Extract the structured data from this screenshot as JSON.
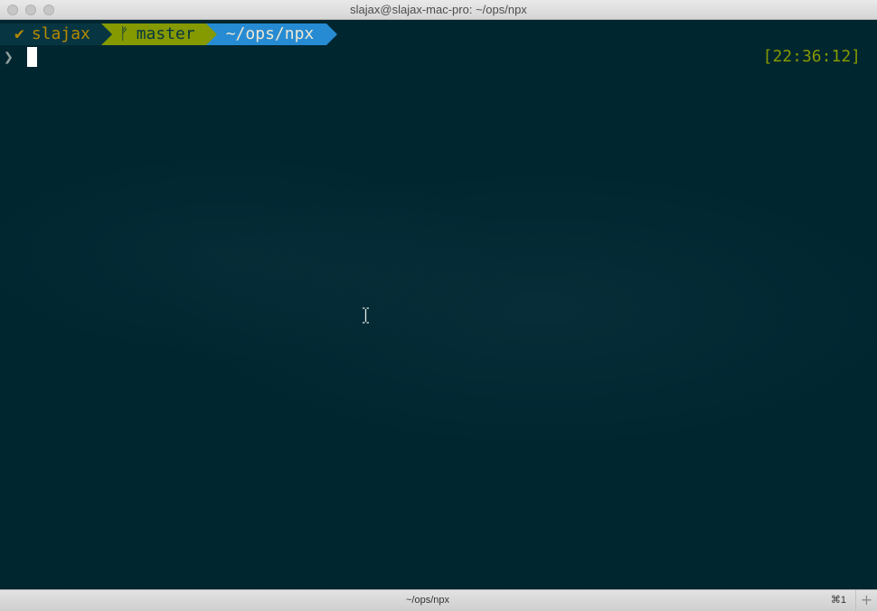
{
  "window": {
    "title": "slajax@slajax-mac-pro: ~/ops/npx"
  },
  "prompt": {
    "status_icon": "✔",
    "user": "slajax",
    "branch_icon": "ᚠ",
    "branch": "master",
    "path": "~/ops/npx",
    "caret": "❯",
    "time": "[22:36:12]",
    "colors": {
      "status_bg": "#073642",
      "status_fg": "#b58900",
      "branch_bg": "#859900",
      "path_bg": "#268bd2",
      "clock_fg": "#859900"
    }
  },
  "tabbar": {
    "tab_label": "~/ops/npx",
    "shortcut": "⌘1",
    "new_tab": "+"
  }
}
